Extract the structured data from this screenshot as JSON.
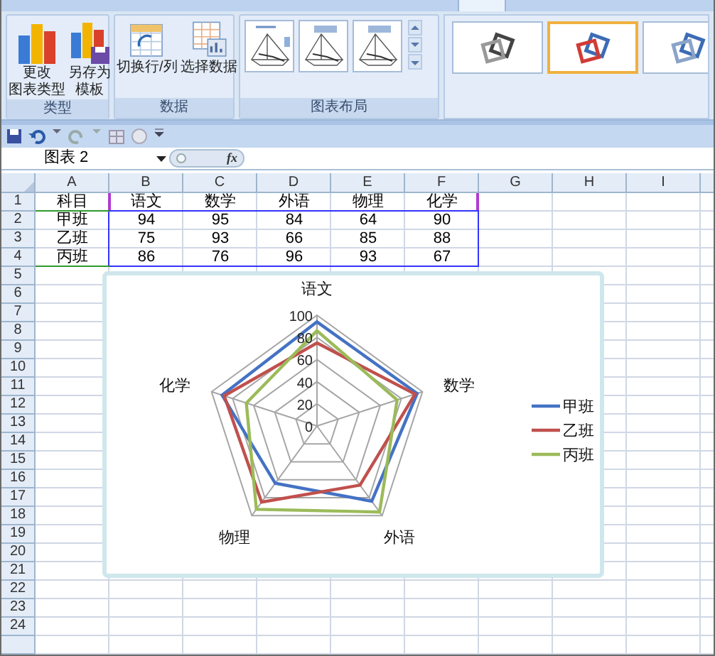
{
  "ribbon": {
    "groups": [
      {
        "label": "类型",
        "buttons": [
          {
            "lines": [
              "更改",
              "图表类型"
            ]
          },
          {
            "lines": [
              "另存为",
              "模板"
            ]
          }
        ]
      },
      {
        "label": "数据",
        "buttons": [
          {
            "lines": [
              "切换行/列"
            ]
          },
          {
            "lines": [
              "选择数据"
            ]
          }
        ]
      },
      {
        "label": "图表布局"
      }
    ],
    "chart_styles": [
      {
        "selected": false
      },
      {
        "selected": true
      },
      {
        "selected": false
      }
    ]
  },
  "name_box": "图表 2",
  "formula_label": "fx",
  "sheet": {
    "columns": [
      "A",
      "B",
      "C",
      "D",
      "E",
      "F",
      "G",
      "H",
      "I"
    ],
    "rows": [
      {
        "number": "1",
        "cells": [
          "科目",
          "语文",
          "数学",
          "外语",
          "物理",
          "化学"
        ]
      },
      {
        "number": "2",
        "cells": [
          "甲班",
          "94",
          "95",
          "84",
          "64",
          "90"
        ]
      },
      {
        "number": "3",
        "cells": [
          "乙班",
          "75",
          "93",
          "66",
          "85",
          "88"
        ]
      },
      {
        "number": "4",
        "cells": [
          "丙班",
          "86",
          "76",
          "96",
          "93",
          "67"
        ]
      },
      {
        "number": "5"
      },
      {
        "number": "6"
      },
      {
        "number": "7"
      },
      {
        "number": "8"
      },
      {
        "number": "9"
      },
      {
        "number": "10"
      },
      {
        "number": "11"
      },
      {
        "number": "12"
      },
      {
        "number": "13"
      },
      {
        "number": "14"
      },
      {
        "number": "15"
      },
      {
        "number": "16"
      },
      {
        "number": "17"
      },
      {
        "number": "18"
      },
      {
        "number": "19"
      },
      {
        "number": "20"
      },
      {
        "number": "21"
      },
      {
        "number": "22"
      },
      {
        "number": "23"
      },
      {
        "number": "24"
      }
    ]
  },
  "chart": {
    "chart_data": {
      "type": "radar",
      "categories": [
        "语文",
        "数学",
        "外语",
        "物理",
        "化学"
      ],
      "series": [
        {
          "name": "甲班",
          "color": "#4472c4",
          "values": [
            94,
            95,
            84,
            64,
            90
          ]
        },
        {
          "name": "乙班",
          "color": "#c0504d",
          "values": [
            75,
            93,
            66,
            85,
            88
          ]
        },
        {
          "name": "丙班",
          "color": "#9bbb59",
          "values": [
            86,
            76,
            96,
            93,
            67
          ]
        }
      ],
      "ylim": [
        0,
        100
      ],
      "yticks": [
        0,
        20,
        40,
        60,
        80,
        100
      ],
      "legend": true
    }
  }
}
